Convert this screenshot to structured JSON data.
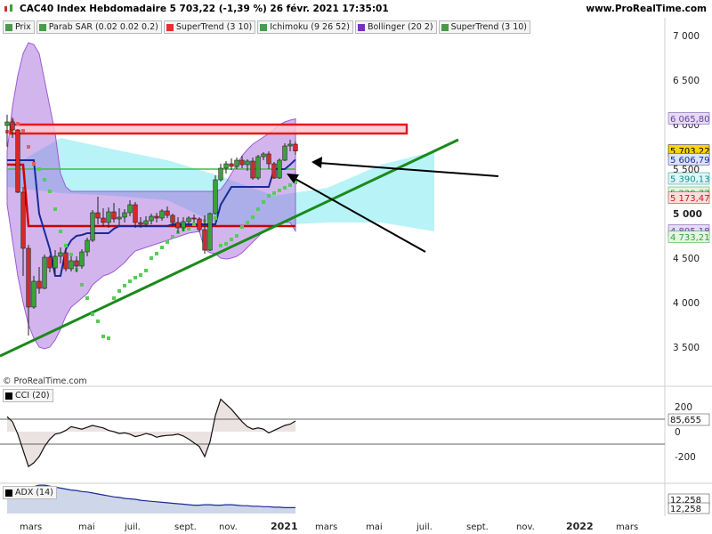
{
  "header": {
    "title": "CAC40 Index Hebdomadaire 5 703,22 (-1,39 %) 26 févr. 2021 17:35:01",
    "site": "www.ProRealTime.com"
  },
  "legend": [
    {
      "label": "Prix",
      "color": "#4a9a4a"
    },
    {
      "label": "Parab SAR (0.02 0.02 0.2)",
      "color": "#4a9a4a"
    },
    {
      "label": "SuperTrend (3 10)",
      "color": "#e83030"
    },
    {
      "label": "Ichimoku (9 26 52)",
      "color": "#4a9a4a"
    },
    {
      "label": "Bollinger (20 2)",
      "color": "#7b2fbe"
    },
    {
      "label": "SuperTrend (3 10)",
      "color": "#4a9a4a"
    }
  ],
  "copyright": "© ProRealTime.com",
  "price_axis": {
    "ticks": [
      "7 000",
      "6 500",
      "6 000",
      "5 500",
      "5 000",
      "4 500",
      "4 000",
      "3 500"
    ],
    "tags": [
      {
        "text": "6 065,80",
        "bg": "#e4dcf3",
        "fg": "#6a3fa8"
      },
      {
        "text": "5 703,22",
        "bg": "#ffd400",
        "fg": "#000000"
      },
      {
        "text": "5 606,79",
        "bg": "#dde3f5",
        "fg": "#1a2a9a"
      },
      {
        "text": "5 390,13",
        "bg": "#dff7f7",
        "fg": "#1a8a8a"
      },
      {
        "text": "5 229,77",
        "bg": "#e3f5e3",
        "fg": "#3aa03a"
      },
      {
        "text": "5 173,47",
        "bg": "#fbdede",
        "fg": "#c41a1a"
      },
      {
        "text": "4 805,18",
        "bg": "#e4dcf3",
        "fg": "#6a3fa8"
      },
      {
        "text": "4 733,21",
        "bg": "#e3f5e3",
        "fg": "#3aa03a"
      }
    ]
  },
  "cci": {
    "label": "CCI (20)",
    "ticks": [
      "200",
      "0",
      "-200"
    ],
    "tag": "85,655"
  },
  "adx": {
    "label": "ADX (14)",
    "tags": [
      "12,258",
      "12,258"
    ]
  },
  "time_axis": [
    "mars",
    "mai",
    "juil.",
    "sept.",
    "nov.",
    "2021",
    "mars",
    "mai",
    "juil.",
    "sept.",
    "nov.",
    "2022",
    "mars"
  ],
  "colors": {
    "up": "#3aa03a",
    "down": "#d22a2a",
    "bollinger": "#9d5ad6",
    "cloud": "#7ee9f0",
    "trend": "#1a8a1a",
    "supertrend_red": "#d10000",
    "supertrend_green": "#3fbf3f",
    "kijun": "#1a2a9a"
  },
  "chart_data": {
    "type": "candlestick",
    "title": "CAC40 Index Hebdomadaire 5 703,22 (-1,39 %) 26 févr. 2021 17:35:01",
    "ylim": [
      3300,
      7200
    ],
    "x_start": "2020-02-21",
    "x_step_weeks": 1,
    "candles": [
      [
        5990,
        6111,
        5750,
        6030
      ],
      [
        6030,
        6080,
        5850,
        5940
      ],
      [
        5940,
        5950,
        5230,
        5240
      ],
      [
        5240,
        5300,
        4300,
        4610
      ],
      [
        4610,
        4650,
        3630,
        3950
      ],
      [
        3950,
        4300,
        3930,
        4240
      ],
      [
        4240,
        4400,
        4100,
        4160
      ],
      [
        4160,
        4540,
        4150,
        4510
      ],
      [
        4510,
        4530,
        4340,
        4390
      ],
      [
        4390,
        4590,
        4320,
        4520
      ],
      [
        4520,
        4620,
        4440,
        4560
      ],
      [
        4560,
        4590,
        4350,
        4380
      ],
      [
        4380,
        4520,
        4350,
        4470
      ],
      [
        4470,
        4520,
        4340,
        4410
      ],
      [
        4410,
        4600,
        4380,
        4570
      ],
      [
        4570,
        4730,
        4520,
        4700
      ],
      [
        4700,
        5040,
        4680,
        5010
      ],
      [
        5010,
        5190,
        4880,
        4950
      ],
      [
        4950,
        5060,
        4850,
        4900
      ],
      [
        4900,
        5070,
        4840,
        5020
      ],
      [
        5020,
        5120,
        4900,
        4940
      ],
      [
        4940,
        5060,
        4870,
        4960
      ],
      [
        4960,
        5050,
        4900,
        5010
      ],
      [
        5010,
        5150,
        4970,
        5100
      ],
      [
        5100,
        5130,
        4840,
        4900
      ],
      [
        4900,
        4960,
        4840,
        4880
      ],
      [
        4880,
        4970,
        4850,
        4920
      ],
      [
        4920,
        5000,
        4880,
        4970
      ],
      [
        4970,
        5010,
        4900,
        4950
      ],
      [
        4950,
        5050,
        4920,
        5030
      ],
      [
        5030,
        5080,
        4950,
        4980
      ],
      [
        4980,
        5000,
        4860,
        4900
      ],
      [
        4900,
        4960,
        4780,
        4840
      ],
      [
        4840,
        4960,
        4800,
        4910
      ],
      [
        4910,
        4970,
        4880,
        4950
      ],
      [
        4950,
        4990,
        4900,
        4940
      ],
      [
        4940,
        4960,
        4790,
        4820
      ],
      [
        4820,
        4980,
        4550,
        4590
      ],
      [
        4590,
        5010,
        4580,
        5000
      ],
      [
        5000,
        5430,
        4990,
        5380
      ],
      [
        5380,
        5560,
        5360,
        5510
      ],
      [
        5510,
        5590,
        5450,
        5560
      ],
      [
        5560,
        5620,
        5490,
        5530
      ],
      [
        5530,
        5630,
        5500,
        5600
      ],
      [
        5600,
        5650,
        5510,
        5550
      ],
      [
        5550,
        5610,
        5480,
        5590
      ],
      [
        5590,
        5630,
        5380,
        5400
      ],
      [
        5400,
        5660,
        5380,
        5640
      ],
      [
        5640,
        5690,
        5600,
        5670
      ],
      [
        5670,
        5700,
        5500,
        5560
      ],
      [
        5560,
        5580,
        5390,
        5400
      ],
      [
        5400,
        5620,
        5390,
        5600
      ],
      [
        5600,
        5790,
        5590,
        5760
      ],
      [
        5760,
        5830,
        5700,
        5780
      ],
      [
        5780,
        5810,
        5660,
        5703
      ]
    ],
    "sar": [
      5920,
      6040,
      6010,
      5930,
      5750,
      5560,
      5500,
      5380,
      5250,
      5050,
      4800,
      4640,
      4540,
      4370,
      4200,
      4050,
      3870,
      3790,
      3620,
      3600,
      4050,
      4130,
      4190,
      4240,
      4280,
      4310,
      4360,
      4500,
      4550,
      4620,
      4680,
      4740,
      4790,
      4820,
      4830,
      4880,
      4900,
      4920,
      4930,
      4950,
      4640,
      4660,
      4710,
      4750,
      4850,
      4900,
      4960,
      5050,
      5130,
      5200,
      5230,
      5260,
      5290,
      5320,
      5350
    ],
    "cloud": {
      "x_weeks": [
        0,
        10,
        20,
        30,
        40,
        50,
        60,
        70,
        80
      ],
      "upper": [
        5500,
        5850,
        5720,
        5600,
        5420,
        5200,
        5290,
        5550,
        5700
      ],
      "lower": [
        5300,
        5230,
        5200,
        5150,
        4870,
        4870,
        4900,
        4900,
        4800
      ]
    },
    "bollinger": {
      "upper": [
        5700,
        6200,
        6550,
        6800,
        6920,
        6900,
        6800,
        6500,
        6200,
        5900,
        5450,
        5300,
        5250,
        5250,
        5250,
        5250,
        5250,
        5250,
        5250,
        5250,
        5250,
        5250,
        5250,
        5250,
        5250,
        5250,
        5250,
        5250,
        5250,
        5250,
        5250,
        5250,
        5250,
        5250,
        5250,
        5250,
        5250,
        5250,
        5250,
        5250,
        5270,
        5350,
        5450,
        5550,
        5650,
        5720,
        5780,
        5820,
        5860,
        5900,
        5950,
        6000,
        6030,
        6050,
        6065
      ],
      "lower": [
        5100,
        4700,
        4300,
        4000,
        3750,
        3600,
        3500,
        3480,
        3500,
        3580,
        3700,
        3850,
        3950,
        4000,
        4050,
        4100,
        4200,
        4250,
        4300,
        4320,
        4350,
        4400,
        4450,
        4520,
        4580,
        4600,
        4620,
        4640,
        4660,
        4680,
        4700,
        4720,
        4740,
        4760,
        4780,
        4790,
        4800,
        4600,
        4560,
        4550,
        4500,
        4490,
        4500,
        4520,
        4560,
        4620,
        4680,
        4740,
        4800,
        4840,
        4860,
        4880,
        4900,
        4900,
        4805
      ]
    },
    "kijun": [
      5600,
      5600,
      5600,
      5600,
      5600,
      5600,
      5000,
      4800,
      4600,
      4300,
      4300,
      4600,
      4700,
      4750,
      4760,
      4780,
      4780,
      4780,
      4780,
      4780,
      4830,
      4860,
      4860,
      4860,
      4860,
      4860,
      4860,
      4860,
      4860,
      4860,
      4860,
      4880,
      4880,
      4880,
      4880,
      4880,
      4880,
      4880,
      4880,
      4880,
      5100,
      5200,
      5300,
      5300,
      5300,
      5300,
      5300,
      5300,
      5300,
      5300,
      5500,
      5500,
      5500,
      5550,
      5607
    ],
    "supertrend_red": [
      5550,
      5550,
      5550,
      5550,
      4860,
      4860,
      4860,
      4860,
      4860,
      4860,
      4860,
      4860,
      4860,
      4860,
      4860,
      4860,
      4860,
      4860,
      4860,
      4860,
      4860,
      4860,
      4860,
      4860,
      4860,
      4860,
      4860,
      4860,
      4860,
      4860,
      4860,
      4860,
      4860,
      4860,
      4860,
      4860,
      4860,
      4860,
      4860,
      4860,
      4860,
      4860,
      4860,
      4860,
      4860,
      4860,
      4860,
      4860,
      4860,
      4860,
      4860,
      4860,
      4860,
      4860,
      4860
    ],
    "supertrend_green": [
      5500,
      5500,
      5500,
      5500,
      5500,
      5500,
      5500,
      5500,
      5500,
      5500,
      5500,
      5500,
      5500,
      5500,
      5500,
      5500,
      5500,
      5500,
      5500,
      5500,
      5500,
      5500,
      5500,
      5500,
      5500,
      5500,
      5500,
      5500,
      5500,
      5500,
      5500,
      5500,
      5500,
      5500,
      5500,
      5500,
      5500,
      5500,
      5500,
      5500,
      5500,
      5500,
      5500,
      5500,
      5500,
      5500,
      5500,
      5500,
      5500,
      5500,
      5500,
      5500,
      5500,
      5500,
      5500
    ],
    "resistance_zone": [
      5900,
      6000
    ],
    "trendline": [
      [
        0,
        3600
      ],
      [
        55,
        5800
      ]
    ],
    "cci": [
      120,
      80,
      -20,
      -150,
      -280,
      -250,
      -200,
      -120,
      -60,
      -20,
      -10,
      10,
      40,
      30,
      20,
      35,
      50,
      40,
      30,
      10,
      0,
      -15,
      -10,
      -20,
      -40,
      -30,
      -15,
      -25,
      -45,
      -35,
      -30,
      -28,
      -20,
      -35,
      -60,
      -90,
      -120,
      -200,
      -80,
      130,
      260,
      220,
      180,
      130,
      80,
      40,
      20,
      30,
      20,
      -10,
      10,
      30,
      50,
      60,
      86
    ],
    "adx": [
      30,
      32,
      35,
      40,
      48,
      55,
      58,
      58,
      56,
      54,
      52,
      50,
      48,
      47,
      45,
      44,
      42,
      40,
      38,
      36,
      34,
      33,
      31,
      30,
      29,
      27,
      26,
      25,
      24,
      23,
      22,
      21,
      20,
      19,
      18,
      17,
      17,
      18,
      18,
      17,
      17,
      18,
      18,
      17,
      16,
      16,
      15,
      15,
      14,
      14,
      13,
      13,
      12,
      12,
      12
    ]
  }
}
